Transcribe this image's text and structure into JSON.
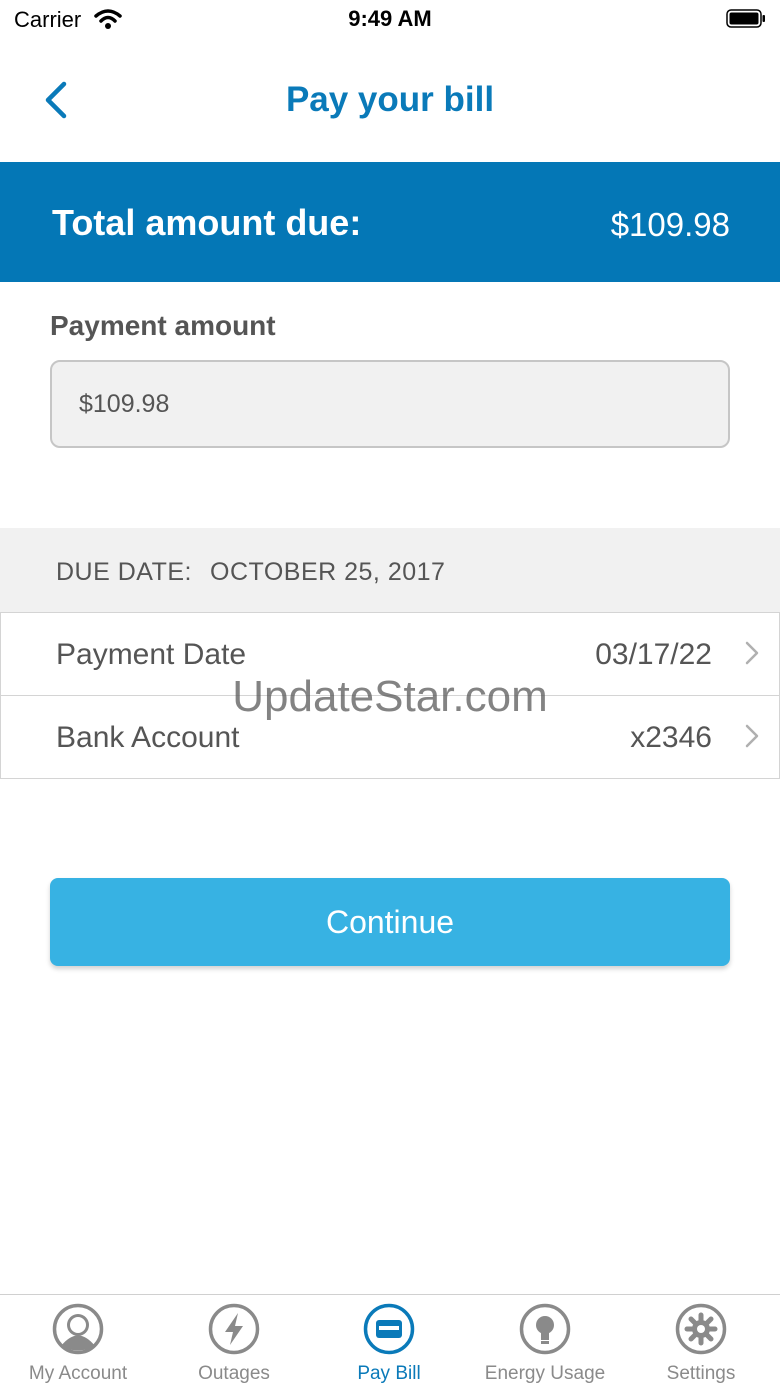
{
  "status_bar": {
    "carrier": "Carrier",
    "time": "9:49 AM"
  },
  "nav": {
    "title": "Pay your bill"
  },
  "total": {
    "label": "Total amount due:",
    "value": "$109.98"
  },
  "payment_amount": {
    "label": "Payment amount",
    "value": "$109.98"
  },
  "due_date": {
    "label": "DUE DATE:",
    "value": "OCTOBER 25, 2017"
  },
  "rows": [
    {
      "label": "Payment Date",
      "value": "03/17/22"
    },
    {
      "label": "Bank Account",
      "value": "x2346"
    }
  ],
  "continue_label": "Continue",
  "watermark": "UpdateStar.com",
  "tabs": [
    {
      "label": "My Account",
      "icon": "person-icon"
    },
    {
      "label": "Outages",
      "icon": "lightning-icon"
    },
    {
      "label": "Pay Bill",
      "icon": "card-icon",
      "active": true
    },
    {
      "label": "Energy Usage",
      "icon": "lightbulb-icon"
    },
    {
      "label": "Settings",
      "icon": "gear-icon"
    }
  ],
  "colors": {
    "brand": "#0477b6",
    "accent": "#37b2e3",
    "title": "#0a7ab9"
  }
}
